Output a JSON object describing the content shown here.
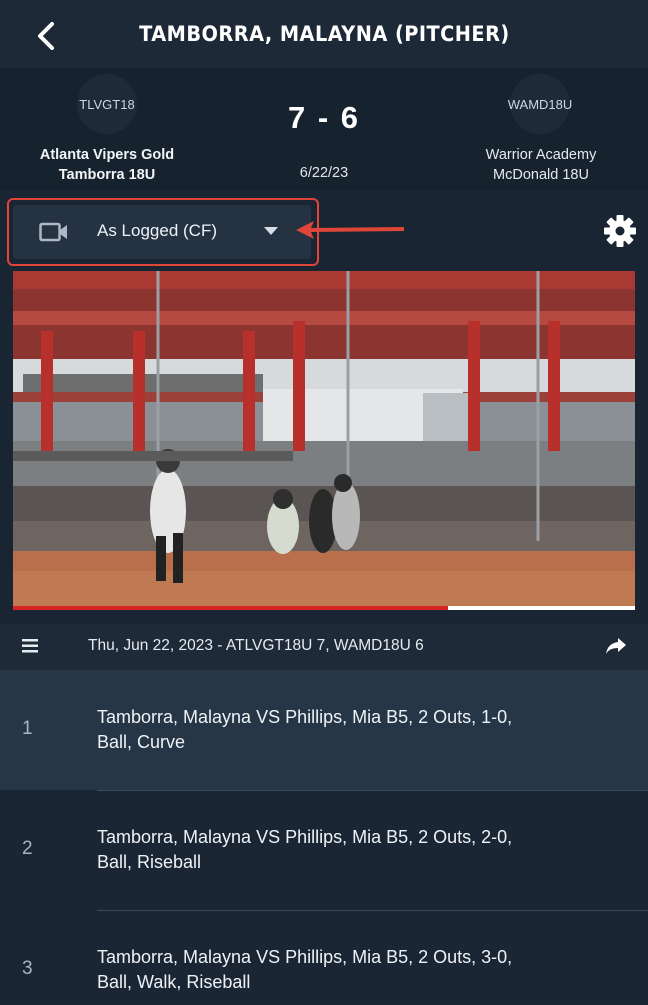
{
  "header": {
    "title": "TAMBORRA, MALAYNA (PITCHER)",
    "back_icon": "chevron-left-icon"
  },
  "game": {
    "home_logo_text": "TLVGT18",
    "home_name_line1": "Atlanta Vipers Gold",
    "home_name_line2": "Tamborra 18U",
    "away_logo_text": "WAMD18U",
    "away_name_line1": "Warrior Academy",
    "away_name_line2": "McDonald 18U",
    "score": "7 - 6",
    "date": "6/22/23"
  },
  "camera": {
    "icon": "video-camera-icon",
    "selected": "As Logged (CF)",
    "dropdown_icon": "caret-down-icon"
  },
  "settings": {
    "icon": "gear-icon"
  },
  "annotation": {
    "color": "#e0453a",
    "arrow_icon": "arrow-left-icon"
  },
  "video": {
    "progress": 0.7,
    "progress_color": "#d62424"
  },
  "list_header": {
    "menu_icon": "hamburger-menu-icon",
    "text": "Thu, Jun 22, 2023 - ATLVGT18U 7, WAMD18U 6",
    "share_icon": "share-arrow-icon"
  },
  "plays": [
    {
      "num": "1",
      "line1": "Tamborra, Malayna VS Phillips, Mia B5, 2 Outs, 1-0,",
      "line2": "Ball, Curve",
      "selected": true
    },
    {
      "num": "2",
      "line1": "Tamborra, Malayna VS Phillips, Mia B5, 2 Outs, 2-0,",
      "line2": "Ball, Riseball",
      "selected": false
    },
    {
      "num": "3",
      "line1": "Tamborra, Malayna VS Phillips, Mia B5, 2 Outs, 3-0,",
      "line2": "Ball, Walk, Riseball",
      "selected": false
    }
  ]
}
